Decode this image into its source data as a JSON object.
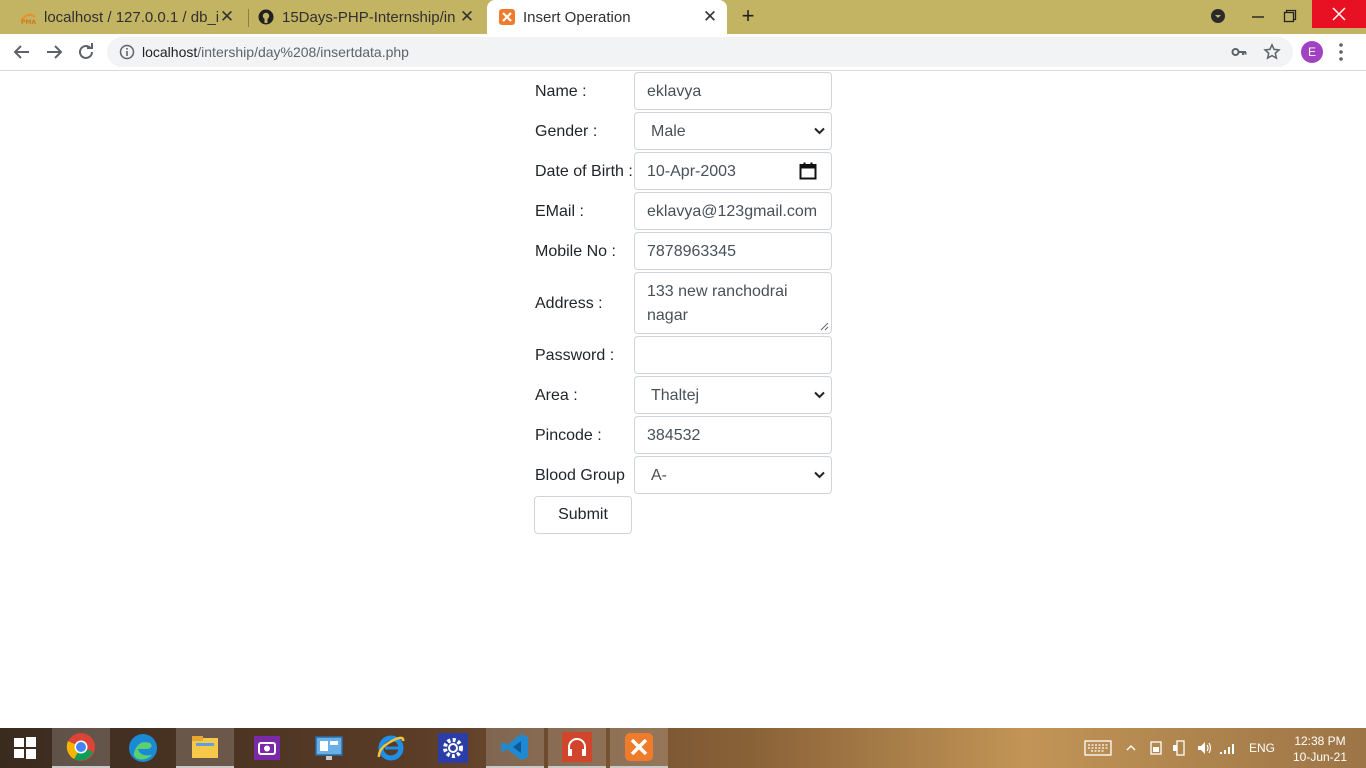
{
  "browser": {
    "tabs": [
      {
        "title": "localhost / 127.0.0.1 / db_i",
        "icon": "phpmyadmin-icon",
        "active": false
      },
      {
        "title": "15Days-PHP-Internship/in",
        "icon": "github-icon",
        "active": false
      },
      {
        "title": "Insert Operation",
        "icon": "xampp-icon",
        "active": true
      }
    ],
    "new_tab": "+",
    "url_host": "localhost",
    "url_path": "/intership/day%208/insertdata.php",
    "profile_initial": "E"
  },
  "form": {
    "fields": [
      {
        "label": "Name :",
        "value": "eklavya",
        "kind": "text"
      },
      {
        "label": "Gender :",
        "value": "Male",
        "kind": "select"
      },
      {
        "label": "Date of Birth :",
        "value": "10-Apr-2003",
        "kind": "date"
      },
      {
        "label": "EMail :",
        "value": "eklavya@123gmail.com",
        "kind": "text"
      },
      {
        "label": "Mobile No :",
        "value": "7878963345",
        "kind": "text"
      },
      {
        "label": "Address :",
        "value": "133 new ranchodrai nagar",
        "kind": "textarea"
      },
      {
        "label": "Password :",
        "value": "",
        "kind": "password"
      },
      {
        "label": "Area :",
        "value": "Thaltej",
        "kind": "select"
      },
      {
        "label": "Pincode :",
        "value": "384532",
        "kind": "text"
      },
      {
        "label": "Blood Group",
        "value": "A-",
        "kind": "select"
      }
    ],
    "submit_label": "Submit"
  },
  "taskbar": {
    "apps": [
      "windows-start-icon",
      "chrome-icon",
      "edge-icon",
      "file-explorer-icon",
      "camera-icon",
      "control-panel-icon",
      "internet-explorer-icon",
      "settings-icon",
      "vscode-icon",
      "music-app-icon",
      "xampp-icon"
    ],
    "language": "ENG",
    "time": "12:38 PM",
    "date": "10-Jun-21"
  },
  "colors": {
    "tab_strip": "#c3b463",
    "field_border": "#ced4da",
    "text": "#212529",
    "profile": "#a142c2"
  }
}
